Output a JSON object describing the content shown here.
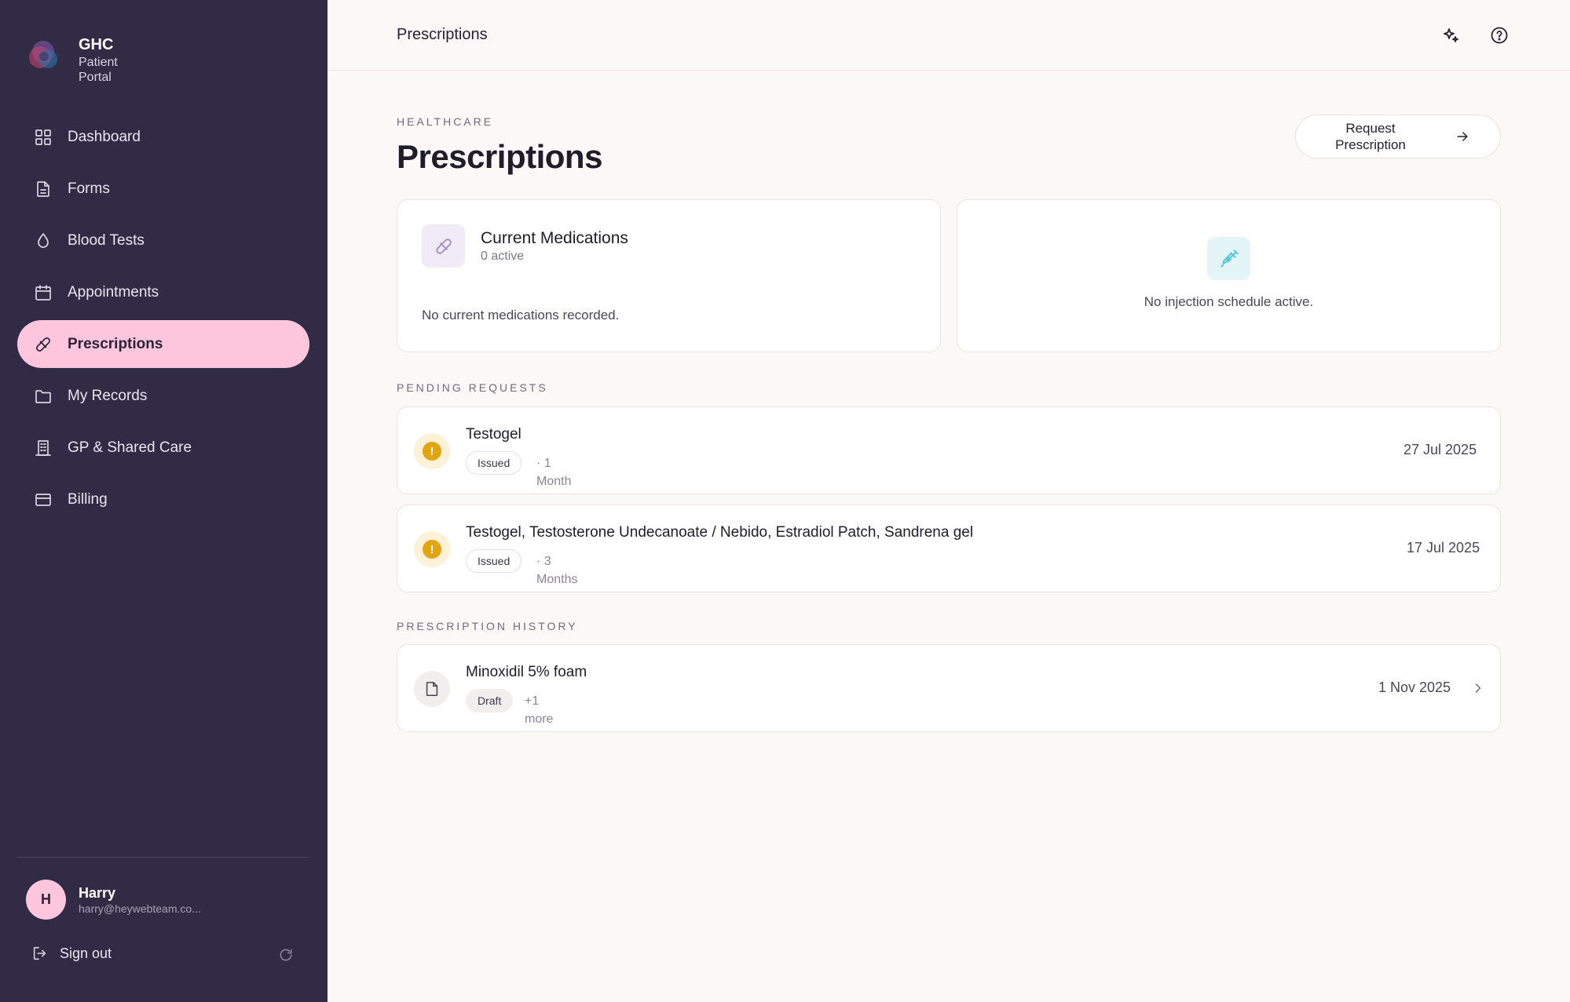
{
  "app": {
    "name": "GHC",
    "subtitle_line1": "Patient",
    "subtitle_line2": "Portal"
  },
  "sidebar": {
    "items": [
      {
        "label": "Dashboard",
        "icon": "grid-icon"
      },
      {
        "label": "Forms",
        "icon": "document-icon"
      },
      {
        "label": "Blood Tests",
        "icon": "droplet-icon"
      },
      {
        "label": "Appointments",
        "icon": "calendar-icon"
      },
      {
        "label": "Prescriptions",
        "icon": "pill-icon",
        "active": true
      },
      {
        "label": "My Records",
        "icon": "folder-icon"
      },
      {
        "label": "GP & Shared Care",
        "icon": "building-icon"
      },
      {
        "label": "Billing",
        "icon": "credit-card-icon"
      }
    ]
  },
  "user": {
    "initial": "H",
    "name": "Harry",
    "email": "harry@heywebteam.co..."
  },
  "signout": {
    "label": "Sign out"
  },
  "topbar": {
    "title": "Prescriptions"
  },
  "header": {
    "eyebrow": "HEALTHCARE",
    "title": "Prescriptions",
    "request_button_line1": "Request",
    "request_button_line2": "Prescription"
  },
  "medications": {
    "title": "Current Medications",
    "subtitle": "0 active",
    "empty": "No current medications recorded."
  },
  "injections": {
    "empty": "No injection schedule active."
  },
  "pending": {
    "label": "PENDING REQUESTS",
    "items": [
      {
        "title": "Testogel",
        "status": "Issued",
        "qty_line1": "· 1",
        "qty_line2": "Month",
        "date": "27 Jul 2025"
      },
      {
        "title": "Testogel, Testosterone Undecanoate / Nebido, Estradiol Patch, Sandrena gel",
        "status": "Issued",
        "qty_line1": "· 3",
        "qty_line2": "Months",
        "date": "17 Jul 2025"
      }
    ]
  },
  "history": {
    "label": "PRESCRIPTION HISTORY",
    "items": [
      {
        "title": "Minoxidil 5% foam",
        "status": "Draft",
        "more_line1": "+1",
        "more_line2": "more",
        "date": "1 Nov 2025"
      }
    ]
  },
  "colors": {
    "sidebar_bg": "#312b45",
    "active_nav": "#fdc6dc",
    "warning": "#e3a412"
  }
}
